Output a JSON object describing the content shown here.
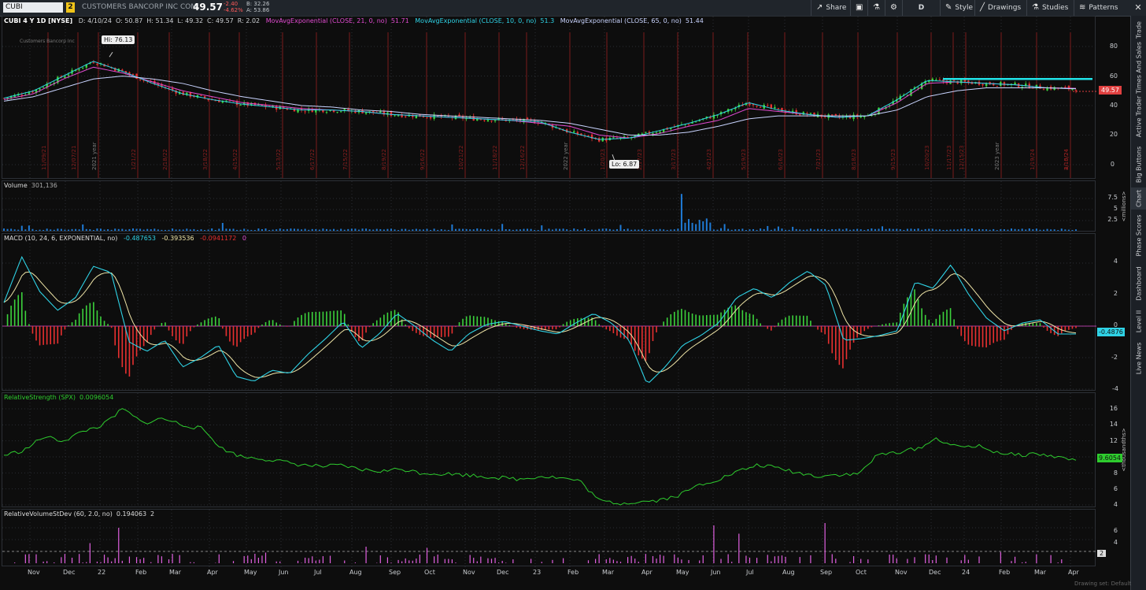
{
  "symbol": "CUBI",
  "link_badge": "2",
  "company": "CUSTOMERS BANCORP INC COM",
  "last_price": "49.57",
  "change": "-2.40",
  "change_pct": "-4.62%",
  "bid": "B: 32.26",
  "ask": "A: 53.86",
  "toolbar": {
    "share": "Share",
    "timeframe": "D",
    "style": "Style",
    "drawings": "Drawings",
    "studies": "Studies",
    "patterns": "Patterns"
  },
  "side_tabs": [
    "Trade",
    "Times And Sales",
    "Active Trader",
    "Big Buttons",
    "Chart",
    "Phase Scores",
    "Dashboard",
    "Level II",
    "Live News"
  ],
  "price_panel": {
    "title": "CUBI 4 Y 1D [NYSE]",
    "ohlc": [
      "D: 4/10/24",
      "O: 50.87",
      "H: 51.34",
      "L: 49.32",
      "C: 49.57",
      "R: 2.02"
    ],
    "ma": [
      {
        "label": "MovAvgExponential (CLOSE, 21, 0, no)",
        "value": "51.71",
        "color": "#e14bd1"
      },
      {
        "label": "MovAvgExponential (CLOSE, 10, 0, no)",
        "value": "51.3",
        "color": "#2fd3e6"
      },
      {
        "label": "MovAvgExponential (CLOSE, 65, 0, no)",
        "value": "51.44",
        "color": "#c9d4ff"
      }
    ],
    "watermark": "Customers Bancorp Inc",
    "hi_label": "Hi: 76.13",
    "lo_label": "Lo: 6.87",
    "price_tag": "49.57",
    "ticks": [
      "80",
      "60",
      "40",
      "20",
      "0"
    ],
    "vertical_labels": [
      "11/09/21",
      "12/07/21",
      "2021 year",
      "1/21/22",
      "2/18/22",
      "3/18/22",
      "4/15/22",
      "5/13/22",
      "6/17/22",
      "7/15/22",
      "8/19/22",
      "9/16/22",
      "10/21/22",
      "11/18/22",
      "12/16/22",
      "2022 year",
      "1/20/23",
      "2/17/23",
      "3/17/23",
      "4/21/23",
      "5/19/23",
      "6/16/23",
      "7/21/23",
      "8/18/23",
      "9/15/23",
      "10/20/23",
      "11/17/23",
      "12/15/23",
      "2023 year",
      "1/19/24",
      "2/16/24",
      "3/15/24",
      "4/10/24"
    ]
  },
  "volume_panel": {
    "title": "Volume",
    "value": "301,136",
    "ticks": [
      "7.5",
      "5",
      "2.5"
    ],
    "unit": "<millions>"
  },
  "macd_panel": {
    "title": "MACD (10, 24, 6, EXPONENTIAL, no)",
    "values": [
      "-0.487653",
      "-0.393536",
      "-0.0941172",
      "0"
    ],
    "ticks": [
      "4",
      "2",
      "0",
      "-2",
      "-4"
    ],
    "tag": "-0.4876"
  },
  "rs_panel": {
    "title": "RelativeStrength (SPX)",
    "value": "0.0096054",
    "ticks": [
      "16",
      "14",
      "12",
      "10",
      "8",
      "6",
      "4"
    ],
    "tag": "9.6054",
    "unit": "<thousandths>"
  },
  "rvs_panel": {
    "title": "RelativeVolumeStDev (60, 2.0, no)",
    "value": "0.194063",
    "extra": "2",
    "ticks": [
      "6",
      "4",
      "2"
    ],
    "tag": "2"
  },
  "months": [
    "Nov",
    "Dec",
    "22",
    "Feb",
    "Mar",
    "Apr",
    "May",
    "Jun",
    "Jul",
    "Aug",
    "Sep",
    "Oct",
    "Nov",
    "Dec",
    "23",
    "Feb",
    "Mar",
    "Apr",
    "May",
    "Jun",
    "Jul",
    "Aug",
    "Sep",
    "Oct",
    "Nov",
    "Dec",
    "24",
    "Feb",
    "Mar",
    "Apr"
  ],
  "drawing_set": "Drawing set: Default",
  "colors": {
    "up": "#3cd23c",
    "down": "#e83030",
    "rs": "#2ecc2e",
    "rvs": "#e060e0",
    "resistance": "#21e3e8"
  },
  "chart_data": {
    "type": "line",
    "series": [
      {
        "name": "MovAvgExponential (CLOSE, 21, 0, no)",
        "values": [
          44,
          48,
          58,
          66,
          62,
          56,
          50,
          46,
          42,
          40,
          38,
          37,
          36,
          34,
          33,
          32,
          31,
          30,
          28,
          26,
          20,
          18,
          21,
          26,
          30,
          38,
          36,
          34,
          32,
          33,
          42,
          55,
          56,
          55,
          54,
          52,
          51.7
        ]
      },
      {
        "name": "MovAvgExponential (CLOSE, 10, 0, no)",
        "values": [
          45,
          50,
          60,
          70,
          63,
          55,
          48,
          44,
          41,
          39,
          37,
          37,
          36,
          34,
          33,
          32,
          31,
          30,
          29,
          22,
          17,
          18,
          23,
          28,
          34,
          42,
          37,
          34,
          32,
          33,
          44,
          57,
          56,
          55,
          54,
          52,
          51.3
        ]
      },
      {
        "name": "MovAvgExponential (CLOSE, 65, 0, no)",
        "values": [
          43,
          46,
          52,
          58,
          60,
          58,
          55,
          50,
          46,
          43,
          40,
          39,
          37,
          36,
          34,
          33,
          32,
          31,
          30,
          28,
          24,
          20,
          20,
          22,
          26,
          31,
          33,
          33,
          33,
          33,
          37,
          46,
          50,
          52,
          52,
          52,
          51.4
        ]
      }
    ],
    "hi": 76.13,
    "lo": 6.87,
    "last": 49.57,
    "ylim": [
      -10,
      95
    ]
  }
}
